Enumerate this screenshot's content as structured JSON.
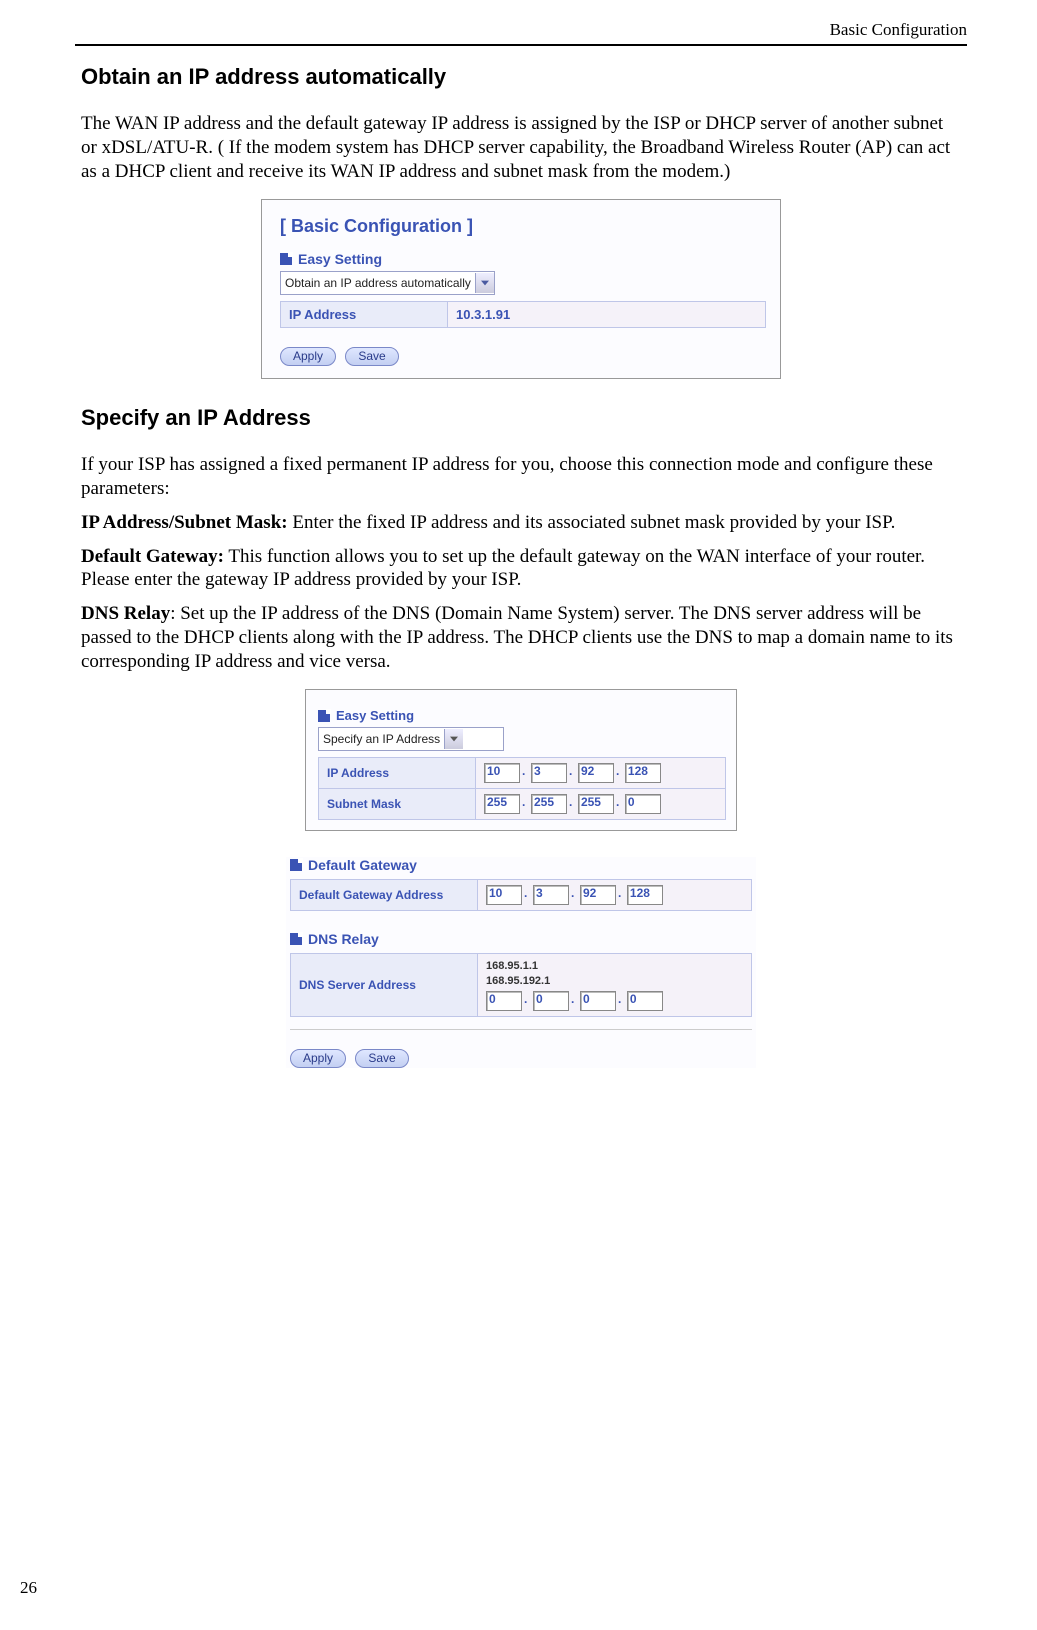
{
  "header": {
    "section_name": "Basic Configuration"
  },
  "page_number": "26",
  "s1": {
    "heading": "Obtain an IP address automatically",
    "para": "The WAN IP address and the default gateway IP address is assigned by the ISP or DHCP server of another subnet or xDSL/ATU-R. ( If the modem system has DHCP server capability, the Broadband Wireless Router (AP) can act as a DHCP client and receive its WAN IP address and subnet mask from the modem.)",
    "panel": {
      "title": "[ Basic Configuration ]",
      "group": "Easy Setting",
      "select_value": "Obtain an IP address automatically",
      "row_key": "IP Address",
      "row_val": "10.3.1.91",
      "btn_apply": "Apply",
      "btn_save": "Save"
    }
  },
  "s2": {
    "heading": "Specify an IP Address",
    "para1": "If your ISP has assigned a fixed permanent IP address for you, choose this connection mode and configure these parameters:",
    "ipmask_label": "IP Address/Subnet Mask:",
    "ipmask_text": " Enter the fixed IP address and its associated subnet mask provided by your ISP.",
    "gw_label": "Default Gateway:",
    "gw_text": " This function allows you to set up the default gateway on the WAN interface of your router. Please enter the gateway IP address provided by your ISP.",
    "dns_label": "DNS Relay",
    "dns_text": ": Set up the IP address of the DNS (Domain Name System) server. The DNS server address will be passed to the DHCP clients along with the IP address. The DHCP clients use the DNS to map a domain name to its corresponding IP address and vice versa.",
    "panel_easy": {
      "group": "Easy Setting",
      "select_value": "Specify an IP Address",
      "row_ip_key": "IP Address",
      "ip": [
        "10",
        "3",
        "92",
        "128"
      ],
      "row_mask_key": "Subnet Mask",
      "mask": [
        "255",
        "255",
        "255",
        "0"
      ]
    },
    "panel_gw": {
      "group": "Default Gateway",
      "row_key": "Default Gateway Address",
      "gw": [
        "10",
        "3",
        "92",
        "128"
      ]
    },
    "panel_dns": {
      "group": "DNS Relay",
      "row_key": "DNS Server Address",
      "known": [
        "168.95.1.1",
        "168.95.192.1"
      ],
      "dns": [
        "0",
        "0",
        "0",
        "0"
      ]
    },
    "btn_apply": "Apply",
    "btn_save": "Save"
  }
}
